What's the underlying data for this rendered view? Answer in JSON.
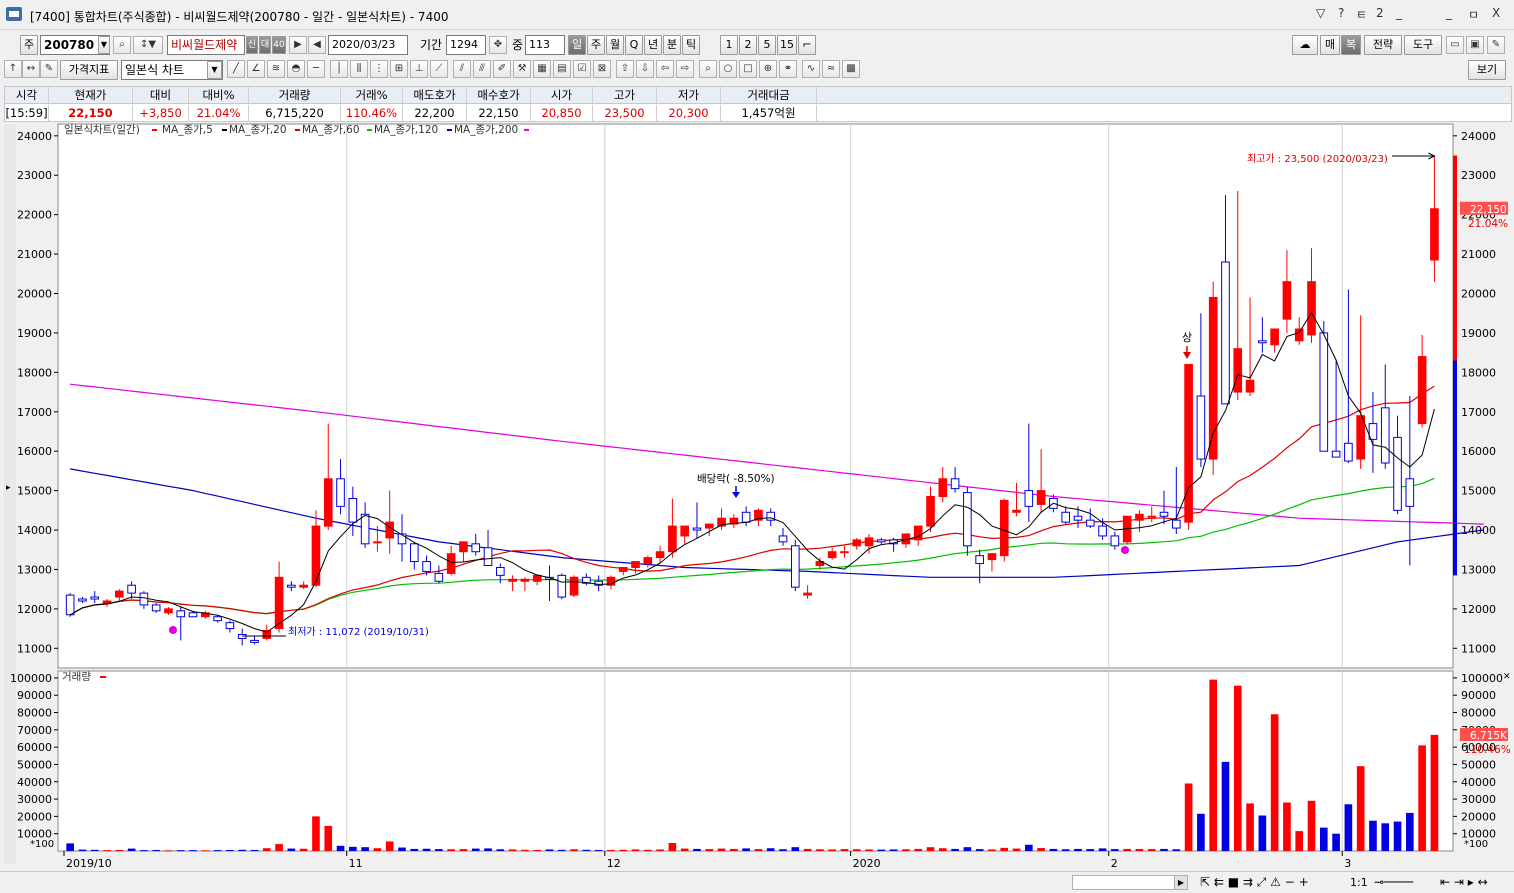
{
  "window": {
    "title": "[7400] 통합차트(주식종합) - 비씨월드제약(200780 - 일간 - 일본식차트) - 7400",
    "controls": [
      "▽",
      "?",
      "ㅌ",
      "2",
      "_",
      "ㅁ",
      "X"
    ]
  },
  "toolbar1": {
    "market_label": "주",
    "code": "200780",
    "name": "비씨월드제약",
    "badges": [
      "신",
      "대",
      "40"
    ],
    "date": "2020/03/23",
    "period_label": "기간",
    "period_value": "1294",
    "count_label": "중",
    "count_value": "113",
    "intervals": [
      "일",
      "주",
      "월",
      "Q",
      "년",
      "분",
      "틱",
      "1",
      "2",
      "5",
      "15"
    ],
    "active_interval": "일",
    "right_buttons": [
      "매",
      "복",
      "전략",
      "도구"
    ]
  },
  "toolbar2": {
    "indicator_label": "가격지표",
    "chart_type": "일본식 차트",
    "view_button": "보기"
  },
  "quote": {
    "headers": [
      "시각",
      "현재가",
      "대비",
      "대비%",
      "거래량",
      "거래%",
      "매도호가",
      "매수호가",
      "시가",
      "고가",
      "저가",
      "거래대금"
    ],
    "values": [
      "[15:59]",
      "22,150",
      "+3,850",
      "21.04%",
      "6,715,220",
      "110.46%",
      "22,200",
      "22,150",
      "20,850",
      "23,500",
      "20,300",
      "1,457억원"
    ]
  },
  "legend": {
    "chart": "일본식차트(일간)",
    "ma5": "MA_종가,5",
    "ma20": "MA_종가,20",
    "ma60": "MA_종가,60",
    "ma120": "MA_종가,120",
    "ma200": "MA_종가,200",
    "volume": "거래량"
  },
  "colors": {
    "up": "#ff0000",
    "down": "#0000e0",
    "ma5": "#000000",
    "ma20": "#e00000",
    "ma60": "#00c000",
    "ma120": "#0000c0",
    "ma200": "#e000e0",
    "grid": "#d0d0d0"
  },
  "chart_data": {
    "type": "candlestick",
    "price_ylim": [
      10500,
      24300
    ],
    "price_ticks": [
      11000,
      12000,
      13000,
      14000,
      15000,
      16000,
      17000,
      18000,
      19000,
      20000,
      21000,
      22000,
      23000,
      24000
    ],
    "volume_ylim": [
      0,
      104000
    ],
    "volume_ticks": [
      10000,
      20000,
      30000,
      40000,
      50000,
      60000,
      70000,
      80000,
      90000,
      100000
    ],
    "volume_unit": "*100",
    "x_labels": [
      {
        "index": 0,
        "label": "2019/10"
      },
      {
        "index": 23,
        "label": "11"
      },
      {
        "index": 44,
        "label": "12"
      },
      {
        "index": 64,
        "label": "2020"
      },
      {
        "index": 85,
        "label": "2"
      },
      {
        "index": 104,
        "label": "3"
      }
    ],
    "candles": [
      [
        12350,
        12400,
        11800,
        11850,
        44
      ],
      [
        12250,
        12300,
        12150,
        12200,
        8
      ],
      [
        12300,
        12450,
        12150,
        12250,
        7
      ],
      [
        12150,
        12250,
        12050,
        12200,
        5
      ],
      [
        12300,
        12500,
        12200,
        12450,
        6
      ],
      [
        12600,
        12700,
        12250,
        12400,
        14
      ],
      [
        12400,
        12450,
        12000,
        12100,
        5
      ],
      [
        12100,
        12150,
        11900,
        11950,
        6
      ],
      [
        11900,
        12050,
        11850,
        12000,
        4
      ],
      [
        11950,
        12050,
        11200,
        11800,
        5
      ],
      [
        11900,
        11950,
        11800,
        11800,
        5
      ],
      [
        11800,
        11950,
        11750,
        11900,
        4
      ],
      [
        11800,
        11850,
        11650,
        11700,
        5
      ],
      [
        11650,
        11700,
        11400,
        11500,
        6
      ],
      [
        11350,
        11500,
        11072,
        11250,
        7
      ],
      [
        11200,
        11300,
        11100,
        11150,
        6
      ],
      [
        11250,
        11600,
        11200,
        11450,
        16
      ],
      [
        11500,
        13200,
        11400,
        12800,
        40
      ],
      [
        12600,
        12700,
        12450,
        12550,
        14
      ],
      [
        12550,
        12700,
        12500,
        12600,
        13
      ],
      [
        12600,
        14500,
        12550,
        14100,
        200
      ],
      [
        14100,
        16700,
        14000,
        15300,
        145
      ],
      [
        15300,
        15800,
        14400,
        14600,
        30
      ],
      [
        14800,
        15100,
        13850,
        14200,
        24
      ],
      [
        14400,
        14700,
        13550,
        13650,
        22
      ],
      [
        13700,
        14100,
        13450,
        13700,
        16
      ],
      [
        13800,
        15000,
        13400,
        14200,
        55
      ],
      [
        13900,
        14400,
        13200,
        13650,
        20
      ],
      [
        13650,
        13700,
        13000,
        13200,
        12
      ],
      [
        13200,
        13350,
        12850,
        12950,
        13
      ],
      [
        12900,
        13100,
        12650,
        12700,
        11
      ],
      [
        12900,
        13600,
        12850,
        13400,
        10
      ],
      [
        13450,
        13600,
        13200,
        13700,
        11
      ],
      [
        13650,
        13900,
        13350,
        13450,
        14
      ],
      [
        13550,
        14000,
        13300,
        13100,
        15
      ],
      [
        13050,
        13150,
        12650,
        12850,
        10
      ],
      [
        12700,
        12850,
        12450,
        12750,
        9
      ],
      [
        12700,
        12800,
        12450,
        12750,
        7
      ],
      [
        12700,
        12850,
        12600,
        12850,
        6
      ],
      [
        12800,
        13100,
        12200,
        12750,
        9
      ],
      [
        12850,
        12900,
        12250,
        12300,
        7
      ],
      [
        12350,
        12850,
        12300,
        12800,
        10
      ],
      [
        12800,
        12900,
        12600,
        12650,
        7
      ],
      [
        12700,
        12850,
        12450,
        12600,
        6
      ],
      [
        12600,
        12850,
        12500,
        12800,
        6
      ],
      [
        12950,
        13050,
        12850,
        13050,
        7
      ],
      [
        13050,
        13150,
        12900,
        13200,
        9
      ],
      [
        13150,
        13350,
        13050,
        13300,
        7
      ],
      [
        13300,
        13600,
        13150,
        13450,
        9
      ],
      [
        13450,
        14800,
        13300,
        14100,
        46
      ],
      [
        13850,
        14050,
        13650,
        14100,
        14
      ],
      [
        14050,
        14700,
        13800,
        14000,
        12
      ],
      [
        14050,
        14100,
        13850,
        14150,
        11
      ],
      [
        14100,
        14550,
        14000,
        14300,
        14
      ],
      [
        14150,
        14400,
        14050,
        14300,
        12
      ],
      [
        14450,
        14600,
        14100,
        14200,
        15
      ],
      [
        14250,
        14550,
        14100,
        14500,
        11
      ],
      [
        14450,
        14550,
        14100,
        14250,
        16
      ],
      [
        13850,
        14050,
        13600,
        13700,
        10
      ],
      [
        13600,
        13750,
        12450,
        12550,
        22
      ],
      [
        12350,
        12600,
        12250,
        12400,
        12
      ],
      [
        13100,
        13300,
        13000,
        13200,
        10
      ],
      [
        13300,
        13550,
        13250,
        13450,
        9
      ],
      [
        13450,
        13600,
        13300,
        13450,
        11
      ],
      [
        13600,
        13800,
        13500,
        13750,
        10
      ],
      [
        13600,
        13900,
        13400,
        13800,
        9
      ],
      [
        13750,
        13800,
        13650,
        13700,
        8
      ],
      [
        13750,
        13800,
        13450,
        13650,
        9
      ],
      [
        13650,
        13850,
        13550,
        13900,
        10
      ],
      [
        13750,
        14000,
        13600,
        14100,
        12
      ],
      [
        14100,
        15100,
        13950,
        14850,
        22
      ],
      [
        14850,
        15600,
        14700,
        15300,
        16
      ],
      [
        15300,
        15600,
        14950,
        15050,
        12
      ],
      [
        14950,
        15100,
        13350,
        13600,
        22
      ],
      [
        13350,
        13500,
        12650,
        13150,
        11
      ],
      [
        13250,
        13350,
        12950,
        13400,
        9
      ],
      [
        13350,
        14800,
        13200,
        14750,
        18
      ],
      [
        14450,
        15200,
        14350,
        14500,
        14
      ],
      [
        15000,
        16700,
        14200,
        14600,
        36
      ],
      [
        14650,
        16050,
        14450,
        15000,
        17
      ],
      [
        14800,
        14900,
        14450,
        14550,
        12
      ],
      [
        14450,
        14600,
        14150,
        14200,
        10
      ],
      [
        14350,
        14600,
        14050,
        14250,
        12
      ],
      [
        14250,
        14550,
        14050,
        14100,
        11
      ],
      [
        14100,
        14300,
        13750,
        13850,
        15
      ],
      [
        13850,
        13950,
        13500,
        13600,
        11
      ],
      [
        13700,
        14350,
        13650,
        14350,
        12
      ],
      [
        14250,
        14500,
        13950,
        14400,
        12
      ],
      [
        14350,
        14600,
        14200,
        14350,
        11
      ],
      [
        14450,
        15000,
        14150,
        14350,
        12
      ],
      [
        14250,
        15600,
        13900,
        14050,
        10
      ],
      [
        14200,
        18200,
        14000,
        18200,
        390
      ],
      [
        17400,
        19500,
        15600,
        15800,
        215
      ],
      [
        15800,
        20300,
        15400,
        19900,
        990
      ],
      [
        20800,
        22500,
        17200,
        17200,
        515
      ],
      [
        17500,
        22600,
        17300,
        18600,
        955
      ],
      [
        17500,
        19900,
        17400,
        17800,
        275
      ],
      [
        18800,
        19400,
        18500,
        18750,
        205
      ],
      [
        18700,
        18750,
        18500,
        19100,
        790
      ],
      [
        19350,
        21100,
        19000,
        20300,
        280
      ],
      [
        18800,
        19400,
        18700,
        19100,
        115
      ],
      [
        18950,
        21150,
        18750,
        20300,
        290
      ],
      [
        19000,
        19300,
        16150,
        16000,
        135
      ],
      [
        16000,
        18300,
        15900,
        15850,
        100
      ],
      [
        16200,
        20100,
        15700,
        15750,
        270
      ],
      [
        15800,
        19450,
        15550,
        16900,
        490
      ],
      [
        16700,
        17500,
        15450,
        16300,
        175
      ],
      [
        17100,
        18200,
        15550,
        15700,
        160
      ],
      [
        16350,
        16900,
        14400,
        14500,
        170
      ],
      [
        15300,
        17400,
        13100,
        14600,
        220
      ],
      [
        16700,
        18950,
        16600,
        18400,
        610
      ],
      [
        20850,
        23500,
        20300,
        22150,
        671
      ]
    ],
    "annotations": {
      "max_label": "최고가 : 23,500 (2020/03/23)",
      "min_label": "최저가 : 11,072 (2019/10/31)",
      "dividend_label": "배당락( -8.50%)",
      "upper_limit_label": "상",
      "last_price_label": "22,150",
      "last_pct_label": "21.04%",
      "last_volume_label": "6,715K",
      "last_volume_pct_label": "110.46%"
    },
    "ma120_points": [
      [
        0,
        15550
      ],
      [
        10,
        15000
      ],
      [
        20,
        14300
      ],
      [
        30,
        13700
      ],
      [
        40,
        13300
      ],
      [
        50,
        13050
      ],
      [
        60,
        12950
      ],
      [
        70,
        12800
      ],
      [
        80,
        12800
      ],
      [
        90,
        12950
      ],
      [
        100,
        13100
      ],
      [
        108,
        13700
      ],
      [
        115,
        14000
      ]
    ],
    "ma200_points": [
      [
        0,
        17700
      ],
      [
        20,
        17000
      ],
      [
        40,
        16250
      ],
      [
        60,
        15550
      ],
      [
        80,
        14850
      ],
      [
        100,
        14300
      ],
      [
        115,
        14150
      ]
    ]
  },
  "statusbar": {
    "ratio": "1:1"
  }
}
